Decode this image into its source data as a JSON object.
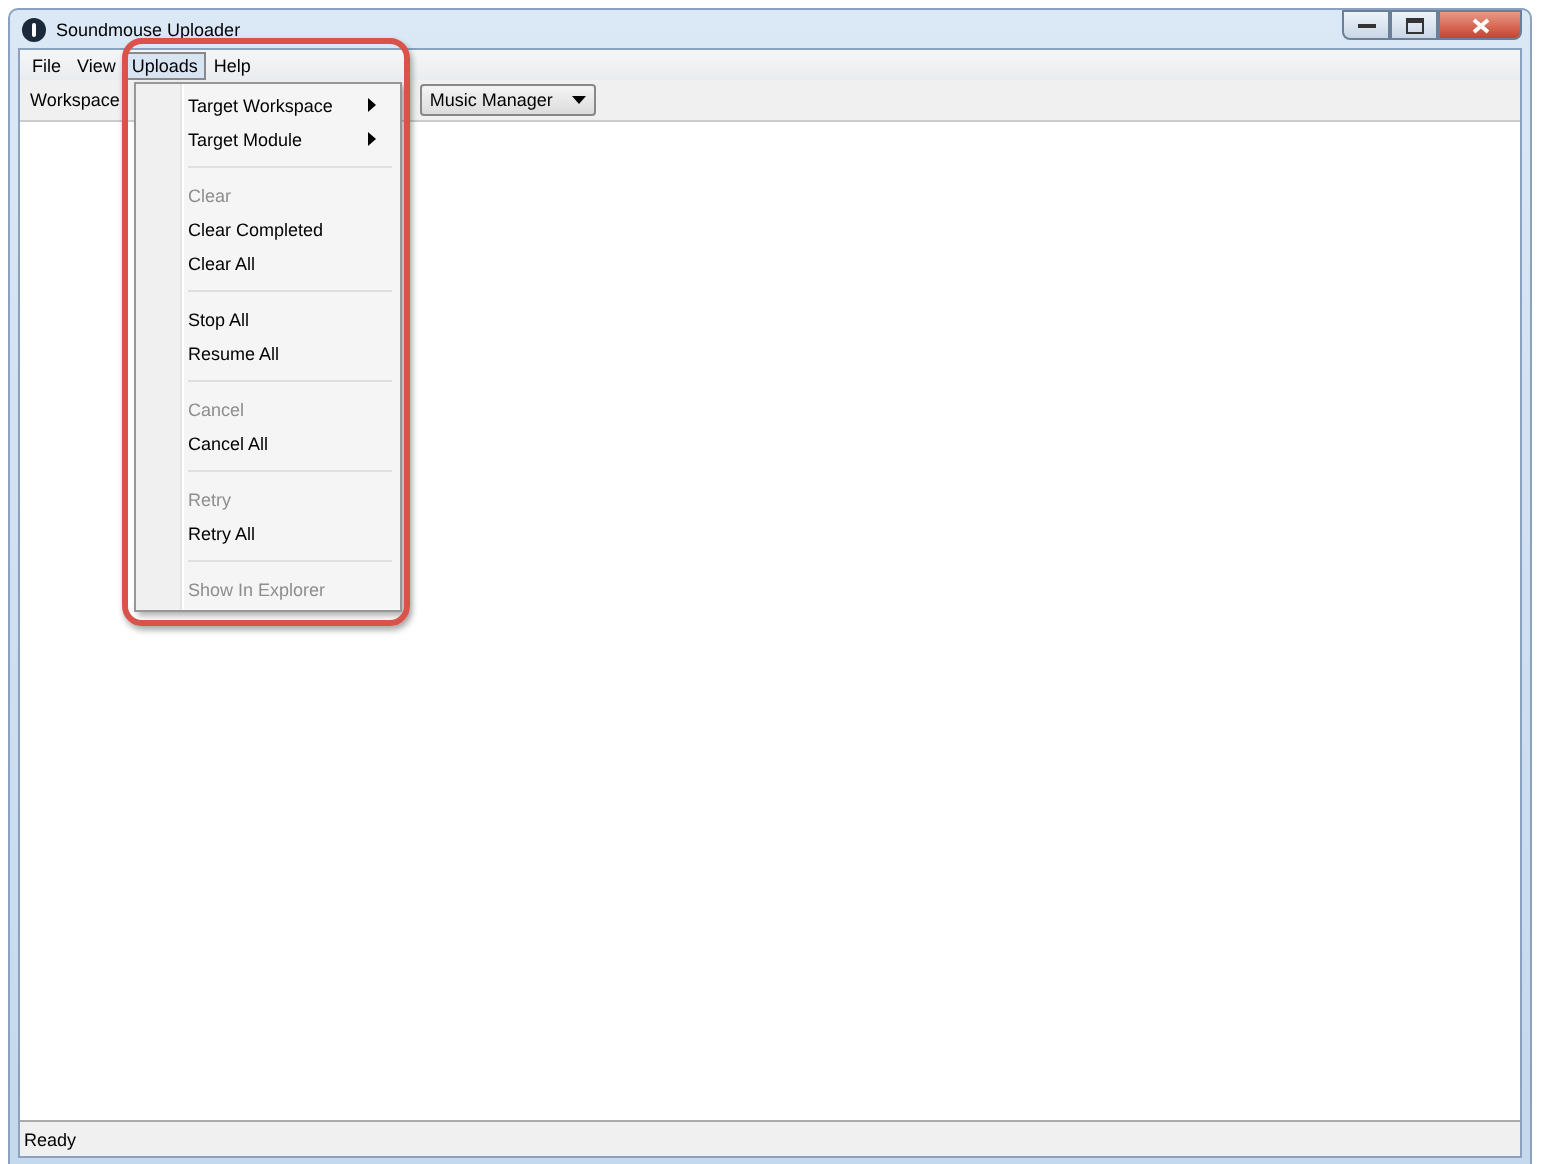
{
  "window": {
    "title": "Soundmouse Uploader"
  },
  "menubar": [
    {
      "label": "File",
      "selected": false
    },
    {
      "label": "View",
      "selected": false
    },
    {
      "label": "Uploads",
      "selected": true
    },
    {
      "label": "Help",
      "selected": false
    }
  ],
  "toolbar": {
    "workspace_label": "Workspace",
    "module_dropdown": "Music Manager"
  },
  "menu": [
    {
      "kind": "submenu",
      "label": "Target Workspace",
      "disabled": false
    },
    {
      "kind": "submenu",
      "label": "Target Module",
      "disabled": false
    },
    {
      "kind": "separator"
    },
    {
      "kind": "item",
      "label": "Clear",
      "disabled": true
    },
    {
      "kind": "item",
      "label": "Clear Completed",
      "disabled": false
    },
    {
      "kind": "item",
      "label": "Clear All",
      "disabled": false
    },
    {
      "kind": "separator"
    },
    {
      "kind": "item",
      "label": "Stop All",
      "disabled": false
    },
    {
      "kind": "item",
      "label": "Resume All",
      "disabled": false
    },
    {
      "kind": "separator"
    },
    {
      "kind": "item",
      "label": "Cancel",
      "disabled": true
    },
    {
      "kind": "item",
      "label": "Cancel All",
      "disabled": false
    },
    {
      "kind": "separator"
    },
    {
      "kind": "item",
      "label": "Retry",
      "disabled": true
    },
    {
      "kind": "item",
      "label": "Retry All",
      "disabled": false
    },
    {
      "kind": "separator"
    },
    {
      "kind": "item",
      "label": "Show In Explorer",
      "disabled": true
    }
  ],
  "status_bar": "Ready"
}
